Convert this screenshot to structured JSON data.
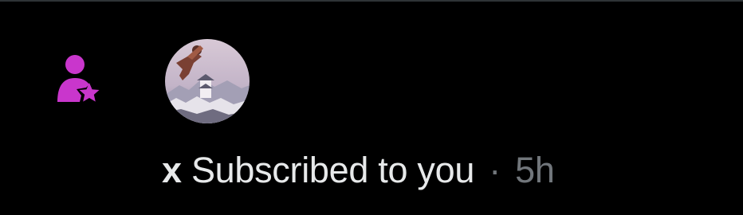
{
  "notification": {
    "type_icon": "person-star-icon",
    "user": {
      "name": "x",
      "avatar_icon": "profile-avatar"
    },
    "action": "Subscribed to you",
    "separator": "·",
    "timestamp": "5h"
  },
  "colors": {
    "background": "#000000",
    "icon_accent": "#c936cc",
    "text_primary": "#e7e9ea",
    "text_secondary": "#71767b",
    "divider": "#2f3336"
  }
}
